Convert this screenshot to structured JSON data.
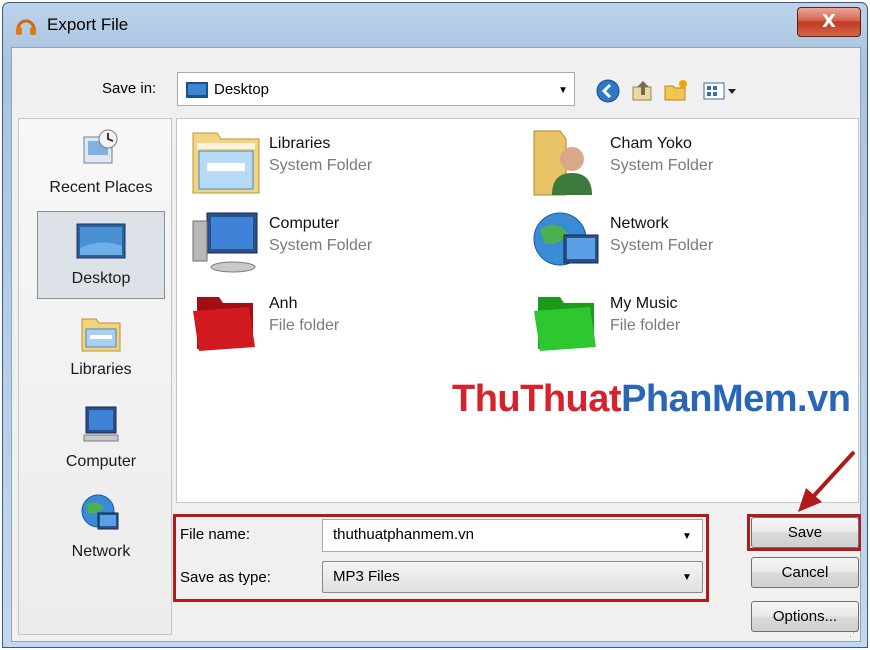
{
  "window": {
    "title": "Export File",
    "close_label": "X"
  },
  "toolbar": {
    "save_in_label": "Save in:",
    "location": "Desktop",
    "icons": [
      "back-icon",
      "up-folder-icon",
      "new-folder-icon",
      "view-menu-icon"
    ]
  },
  "places": [
    {
      "label": "Recent Places",
      "icon": "recent-places-icon"
    },
    {
      "label": "Desktop",
      "icon": "desktop-icon",
      "selected": true
    },
    {
      "label": "Libraries",
      "icon": "libraries-icon"
    },
    {
      "label": "Computer",
      "icon": "computer-icon"
    },
    {
      "label": "Network",
      "icon": "network-icon"
    }
  ],
  "files": [
    {
      "name": "Libraries",
      "type": "System Folder",
      "icon": "libraries-folder-icon"
    },
    {
      "name": "Cham Yoko",
      "type": "System Folder",
      "icon": "user-folder-icon"
    },
    {
      "name": "Computer",
      "type": "System Folder",
      "icon": "computer-icon"
    },
    {
      "name": "Network",
      "type": "System Folder",
      "icon": "network-icon"
    },
    {
      "name": "Anh",
      "type": "File folder",
      "icon": "red-folder-icon"
    },
    {
      "name": "My Music",
      "type": "File folder",
      "icon": "green-folder-icon"
    }
  ],
  "watermark": {
    "part1": "ThuThuat",
    "part2": "PhanMem.vn",
    "color1": "#d8212a",
    "color2": "#2a66b7"
  },
  "form": {
    "file_name_label": "File name:",
    "file_name_value": "thuthuatphanmem.vn",
    "save_type_label": "Save as type:",
    "save_type_value": "MP3 Files"
  },
  "buttons": {
    "save": "Save",
    "cancel": "Cancel",
    "options": "Options..."
  },
  "colors": {
    "highlight": "#b01a1a",
    "selection": "#dde2e8"
  }
}
